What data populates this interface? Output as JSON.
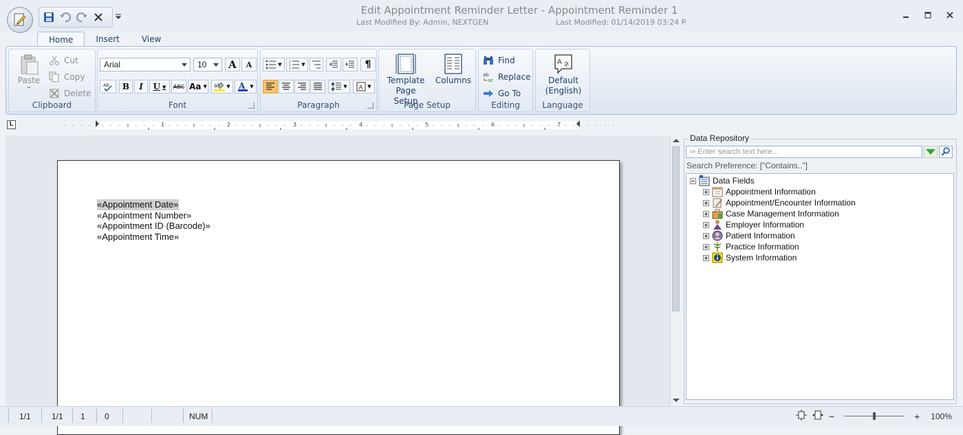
{
  "window": {
    "title": "Edit Appointment Reminder Letter - Appointment Reminder 1",
    "modified_by": "Last Modified By: Admin, NEXTGEN",
    "modified_on": "Last Modified: 01/14/2019 03:24 P"
  },
  "tabs": [
    {
      "label": "Home",
      "active": true
    },
    {
      "label": "Insert",
      "active": false
    },
    {
      "label": "View",
      "active": false
    }
  ],
  "ribbon": {
    "clipboard": {
      "label": "Clipboard",
      "paste": "Paste",
      "cut": "Cut",
      "copy": "Copy",
      "delete": "Delete"
    },
    "font": {
      "label": "Font",
      "family": "Arial",
      "size": "10",
      "bold": "B",
      "italic": "I",
      "underline": "U",
      "strike": "ABC",
      "case": "Aa",
      "grow": "A",
      "shrink": "A"
    },
    "paragraph": {
      "label": "Paragraph",
      "pilcrow": "¶"
    },
    "page_setup": {
      "label": "Page Setup",
      "template_line1": "Template",
      "template_line2": "Page Setup",
      "columns": "Columns"
    },
    "editing": {
      "label": "Editing",
      "find": "Find",
      "replace": "Replace",
      "goto": "Go To"
    },
    "language": {
      "label": "Language",
      "default_line1": "Default",
      "default_line2": "(English)"
    }
  },
  "ruler": {
    "corner": "L",
    "numbers": [
      "1",
      "2",
      "3",
      "4",
      "5",
      "6",
      "7"
    ]
  },
  "document": {
    "fields": [
      {
        "text": "«Appointment Date»",
        "selected": true
      },
      {
        "text": "«Appointment Number»",
        "selected": false
      },
      {
        "text": "«Appointment ID (Barcode)»",
        "selected": false
      },
      {
        "text": "«Appointment Time»",
        "selected": false
      }
    ]
  },
  "repository": {
    "title": "Data Repository",
    "search_placeholder": "⇒ Enter search text here...",
    "search_preference": "Search Preference: [\"Contains..\"]",
    "root": "Data Fields",
    "items": [
      "Appointment Information",
      "Appointment/Encounter Information",
      "Case Management Information",
      "Employer Information",
      "Patient Information",
      "Practice Information",
      "System Information"
    ]
  },
  "status": {
    "page1": "1/1",
    "page2": "1/1",
    "line": "1",
    "col": "0",
    "num": "NUM",
    "zoom": "100%"
  },
  "colors": {
    "accent": "#f8c16a",
    "ribbon": "#dde6f1",
    "link": "#1e3f6a"
  }
}
